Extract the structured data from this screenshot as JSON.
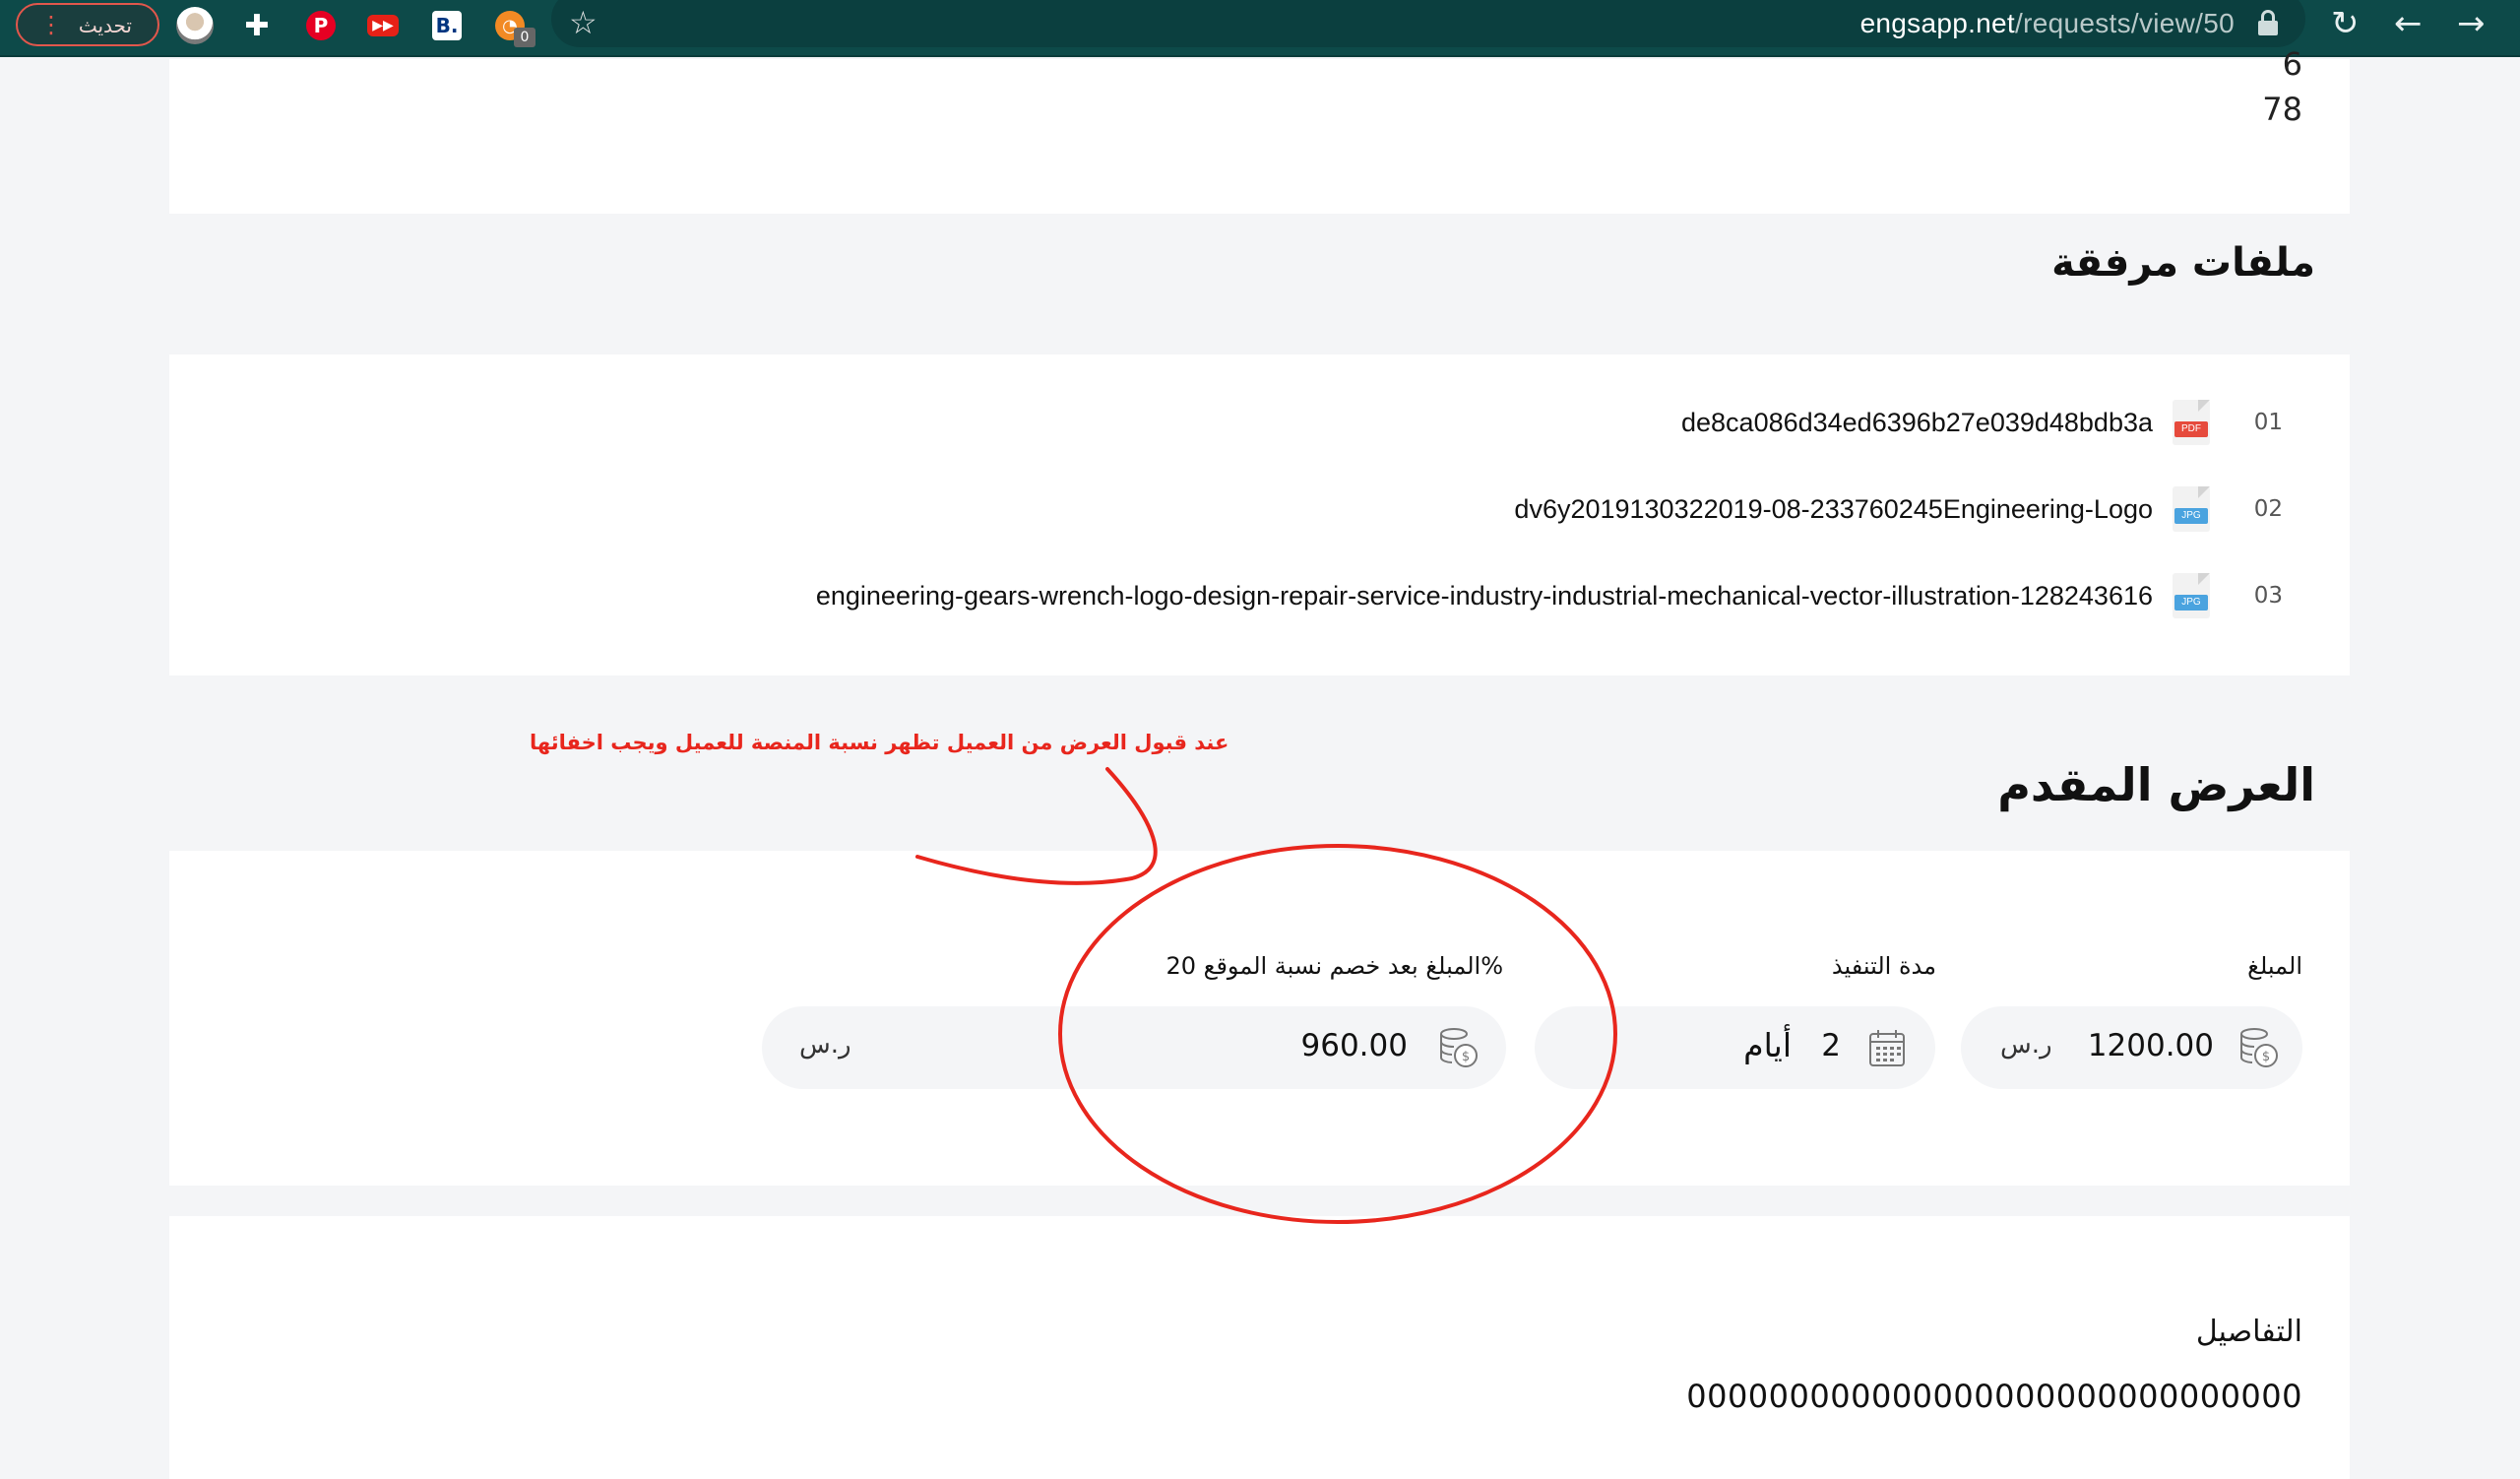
{
  "browser": {
    "update_label": "تحديث",
    "url_host": "engsapp.net",
    "url_path": "/requests/view/50",
    "rss_badge": "0",
    "extensions": [
      "profile-avatar",
      "puzzle-icon",
      "pinterest-icon",
      "youtube-icon",
      "booking-icon",
      "rss-icon"
    ]
  },
  "top_values": [
    "6",
    "78"
  ],
  "attachments": {
    "title": "ملفات مرفقة",
    "files": [
      {
        "index": "01",
        "type": "PDF",
        "name": "de8ca086d34ed6396b27e039d48bdb3a"
      },
      {
        "index": "02",
        "type": "JPG",
        "name": "dv6y2019130322019-08-233760245Engineering-Logo"
      },
      {
        "index": "03",
        "type": "JPG",
        "name": "engineering-gears-wrench-logo-design-repair-service-industry-industrial-mechanical-vector-illustration-128243616"
      }
    ]
  },
  "annotation": {
    "text": "عند قبول العرض من العميل تظهر نسبة المنصة للعميل ويجب اخفائها",
    "color": "#e8261d"
  },
  "offer": {
    "title": "العرض المقدم",
    "amount_label": "المبلغ",
    "amount_value": "1200.00",
    "amount_unit": "ر.س",
    "duration_label": "مدة التنفيذ",
    "duration_value": "2",
    "duration_unit": "أيام",
    "net_label": "المبلغ بعد خصم نسبة الموقع 20%",
    "net_value": "960.00",
    "net_unit": "ر.س"
  },
  "details": {
    "label": "التفاصيل",
    "value": "000000000000000000000000000000"
  },
  "colors": {
    "browser_bar": "#0d4a49",
    "page_bg": "#f4f5f7",
    "annotation_red": "#e8261d"
  }
}
